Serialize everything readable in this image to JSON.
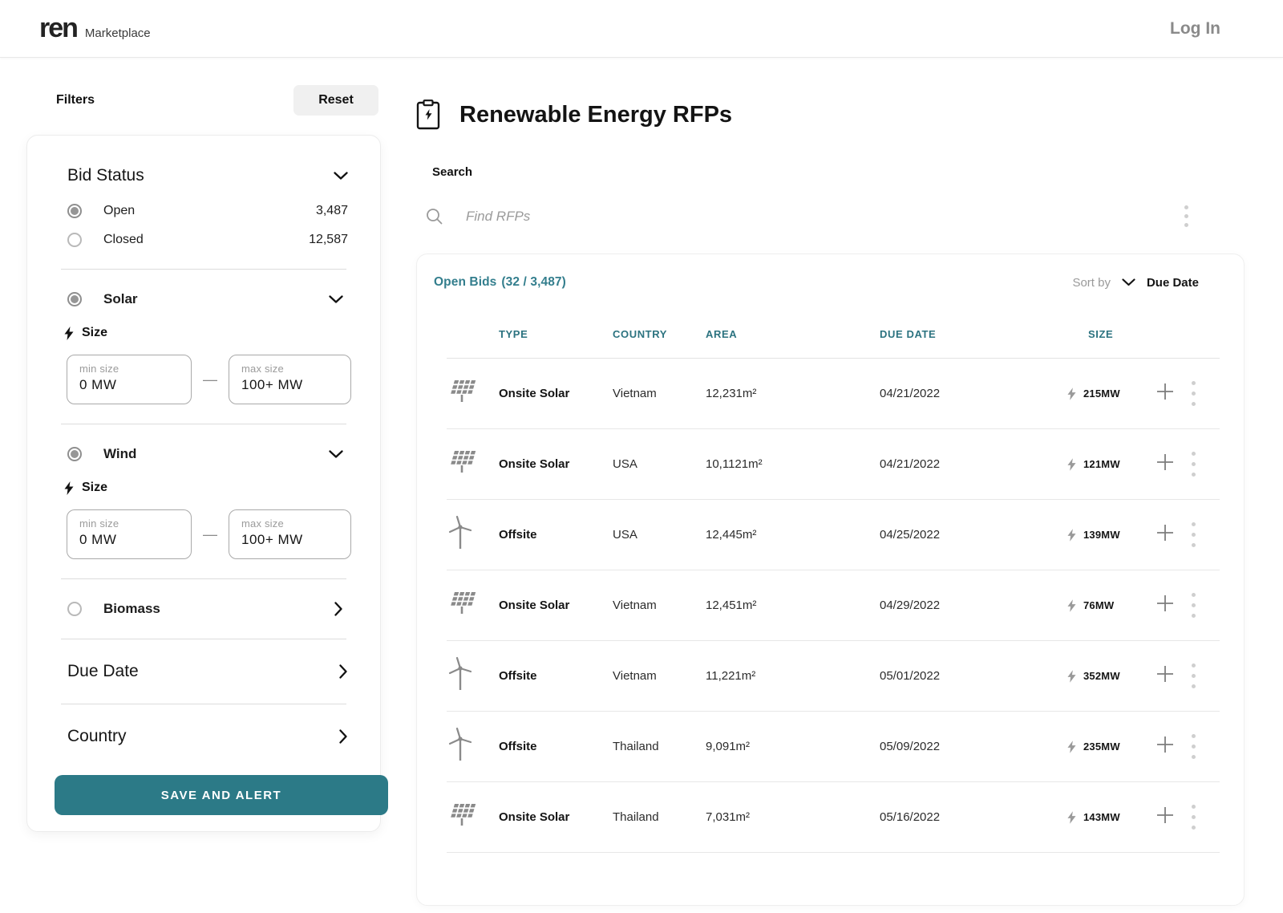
{
  "nav": {
    "logo": "ren",
    "logo_suffix": "Marketplace",
    "login_label": "Log In"
  },
  "filters": {
    "title": "Filters",
    "reset_label": "Reset",
    "bid_status": {
      "label": "Bid Status",
      "options": [
        {
          "label": "Open",
          "count": "3,487",
          "selected": true
        },
        {
          "label": "Closed",
          "count": "12,587",
          "selected": false
        }
      ]
    },
    "solar": {
      "label": "Solar",
      "selected": true,
      "size_label": "Size",
      "min_label": "min size",
      "min_value": "0  MW",
      "max_label": "max size",
      "max_value": "100+  MW",
      "range_separator": "—"
    },
    "wind": {
      "label": "Wind",
      "selected": true,
      "size_label": "Size",
      "min_label": "min size",
      "min_value": "0  MW",
      "max_label": "max size",
      "max_value": "100+  MW",
      "range_separator": "—"
    },
    "biomass": {
      "label": "Biomass",
      "selected": false
    },
    "due_date_label": "Due Date",
    "country_label": "Country",
    "save_button_label": "SAVE AND ALERT"
  },
  "main": {
    "title": "Renewable Energy RFPs",
    "search_label": "Search",
    "search_placeholder": "Find RFPs",
    "results": {
      "header": "Open Bids",
      "count": "(32 / 3,487)",
      "sort_label": "Sort by",
      "sort_value": "Due Date",
      "columns": {
        "type": "TYPE",
        "country": "COUNTRY",
        "area": "AREA",
        "due": "DUE DATE",
        "size": "SIZE"
      },
      "rows": [
        {
          "icon": "solar-panel",
          "type": "Onsite Solar",
          "country": "Vietnam",
          "area": "12,231m²",
          "due": "04/21/2022",
          "size": "215MW"
        },
        {
          "icon": "solar-panel",
          "type": "Onsite Solar",
          "country": "USA",
          "area": "10,1121m²",
          "due": "04/21/2022",
          "size": "121MW"
        },
        {
          "icon": "wind-turbine",
          "type": "Offsite",
          "country": "USA",
          "area": "12,445m²",
          "due": "04/25/2022",
          "size": "139MW"
        },
        {
          "icon": "solar-panel",
          "type": "Onsite Solar",
          "country": "Vietnam",
          "area": "12,451m²",
          "due": "04/29/2022",
          "size": "76MW"
        },
        {
          "icon": "wind-turbine",
          "type": "Offsite",
          "country": "Vietnam",
          "area": "11,221m²",
          "due": "05/01/2022",
          "size": "352MW"
        },
        {
          "icon": "wind-turbine",
          "type": "Offsite",
          "country": "Thailand",
          "area": "9,091m²",
          "due": "05/09/2022",
          "size": "235MW"
        },
        {
          "icon": "solar-panel",
          "type": "Onsite Solar",
          "country": "Thailand",
          "area": "7,031m²",
          "due": "05/16/2022",
          "size": "143MW"
        }
      ]
    }
  },
  "colors": {
    "accent_teal": "#2C7A87",
    "header_teal": "#2C7380",
    "link_teal": "#337E8D"
  }
}
